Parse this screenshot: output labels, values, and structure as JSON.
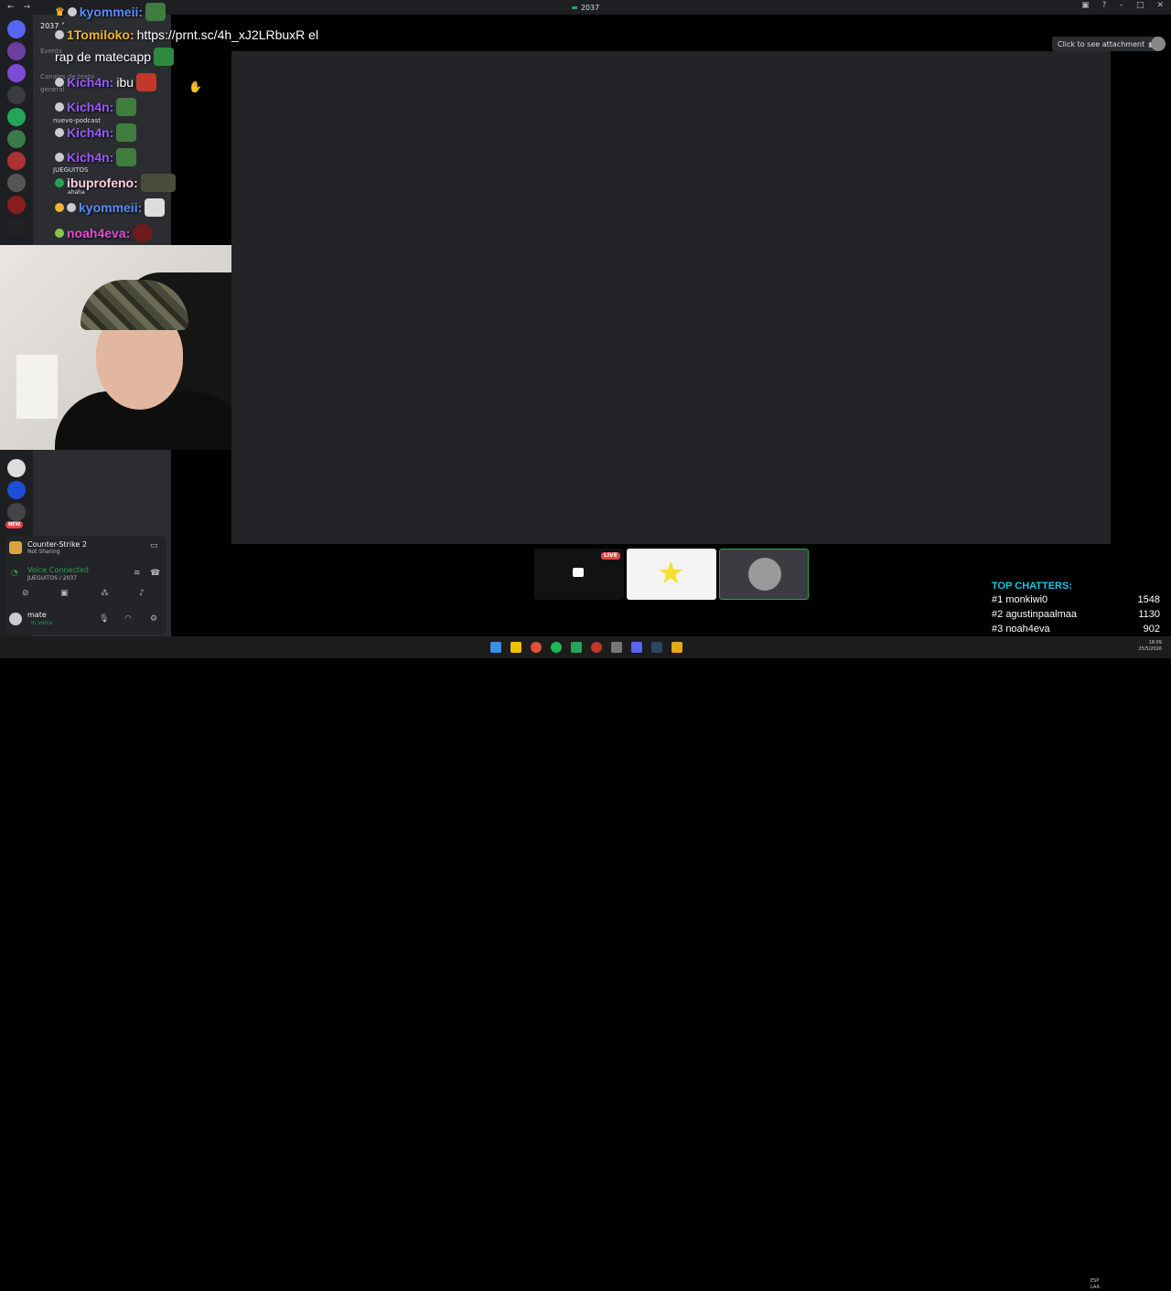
{
  "window": {
    "title": "2037"
  },
  "guild": {
    "name": "2037 ˅"
  },
  "channels": [
    {
      "label": "Events"
    },
    {
      "label": "Canales de texto"
    },
    {
      "label": "general"
    },
    {
      "label": "nuevo-podcast"
    },
    {
      "label": "JUEGUITOS"
    },
    {
      "label": "ahaha"
    }
  ],
  "chat": [
    {
      "user": "kyommeii:",
      "color": "#5a8cff",
      "text": ""
    },
    {
      "user": "1Tomiloko:",
      "color": "#f0b232",
      "text": "https://prnt.sc/4h_xJ2LRbuxR el"
    },
    {
      "user": "",
      "color": "#fff",
      "text": "rap de matecapp"
    },
    {
      "user": "Kich4n:",
      "color": "#9b59ff",
      "text": "ibu"
    },
    {
      "user": "Kich4n:",
      "color": "#9b59ff",
      "text": ""
    },
    {
      "user": "Kich4n:",
      "color": "#9b59ff",
      "text": ""
    },
    {
      "user": "Kich4n:",
      "color": "#9b59ff",
      "text": ""
    },
    {
      "user": "ibuprofeno:",
      "color": "#ffd0e0",
      "text": ""
    },
    {
      "user": "kyommeii:",
      "color": "#5a8cff",
      "text": ""
    },
    {
      "user": "noah4eva:",
      "color": "#e34bd8",
      "text": ""
    }
  ],
  "main": {
    "attachment_label": "Click to see attachment"
  },
  "tiles": {
    "live_label": "LIVE"
  },
  "panel": {
    "game": "Counter-Strike 2",
    "game_status": "Not Sharing",
    "voice": "Voice Connected",
    "voice_sub": "JUEGUITOS / 2037",
    "user": "mate",
    "user_status": "In voice"
  },
  "servers": {
    "new_badge": "NEW"
  },
  "top_chatters": {
    "title": "TOP CHATTERS:",
    "rows": [
      {
        "rank": "#1",
        "name": "monkiwi0",
        "count": "1548"
      },
      {
        "rank": "#2",
        "name": "agustinpaalmaa",
        "count": "1130"
      },
      {
        "rank": "#3",
        "name": "noah4eva",
        "count": "902"
      }
    ]
  },
  "tray": {
    "lang": "ESP",
    "lang2": "LAA",
    "time": "18:09",
    "date": "25/5/2026"
  },
  "colors": {
    "accent_green": "#23a559",
    "chatters_title": "#19c3e6",
    "live_red": "#ed4245"
  }
}
